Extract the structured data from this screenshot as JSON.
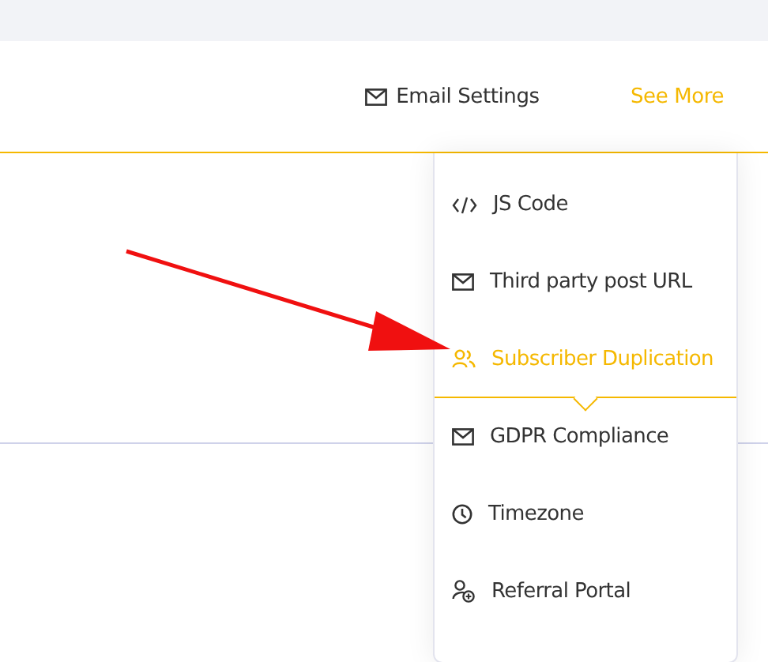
{
  "tabs": [
    {
      "label": "Email Settings",
      "kind": "mail",
      "selected": false
    },
    {
      "label": "See More",
      "kind": "plain",
      "selected": true
    }
  ],
  "menu": {
    "items": [
      {
        "label": "JS Code",
        "kind": "code",
        "selected": false
      },
      {
        "label": "Third party post URL",
        "kind": "mail",
        "selected": false
      },
      {
        "label": "Subscriber Duplication",
        "kind": "users",
        "selected": true
      },
      {
        "label": "GDPR Compliance",
        "kind": "mail",
        "selected": false
      },
      {
        "label": "Timezone",
        "kind": "clock",
        "selected": false
      },
      {
        "label": "Referral Portal",
        "kind": "user-plus",
        "selected": false
      }
    ]
  }
}
